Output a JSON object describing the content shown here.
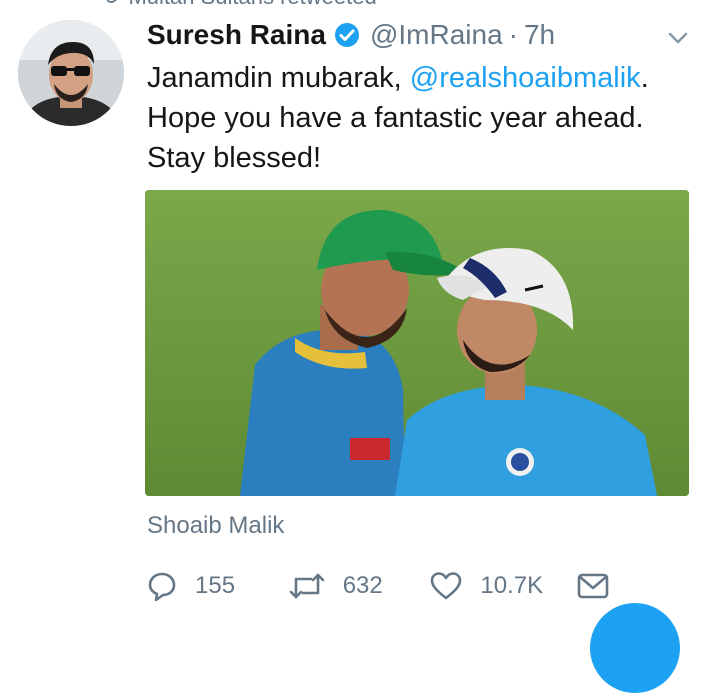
{
  "retweet_context": {
    "icon": "retweet-icon",
    "text": "Multan Sultans retweeted"
  },
  "tweet": {
    "author": {
      "display_name": "Suresh Raina",
      "verified": true,
      "handle": "@ImRaina",
      "separator": "·",
      "time": "7h",
      "avatar_icon": "avatar"
    },
    "text": {
      "prefix": "Janamdin mubarak, ",
      "mention": "@realshoaibmalik",
      "suffix": ".",
      "line2": "Hope you have a fantastic year ahead.",
      "line3": "Stay blessed!"
    },
    "media": {
      "type": "photo"
    },
    "tagged_user": "Shoaib Malik",
    "actions": {
      "reply_count": "155",
      "retweet_count": "632",
      "like_count": "10.7K"
    }
  },
  "colors": {
    "link_blue": "#1da1f2",
    "text_primary": "#14171a",
    "text_secondary": "#657786",
    "verified_blue": "#1da1f2"
  }
}
